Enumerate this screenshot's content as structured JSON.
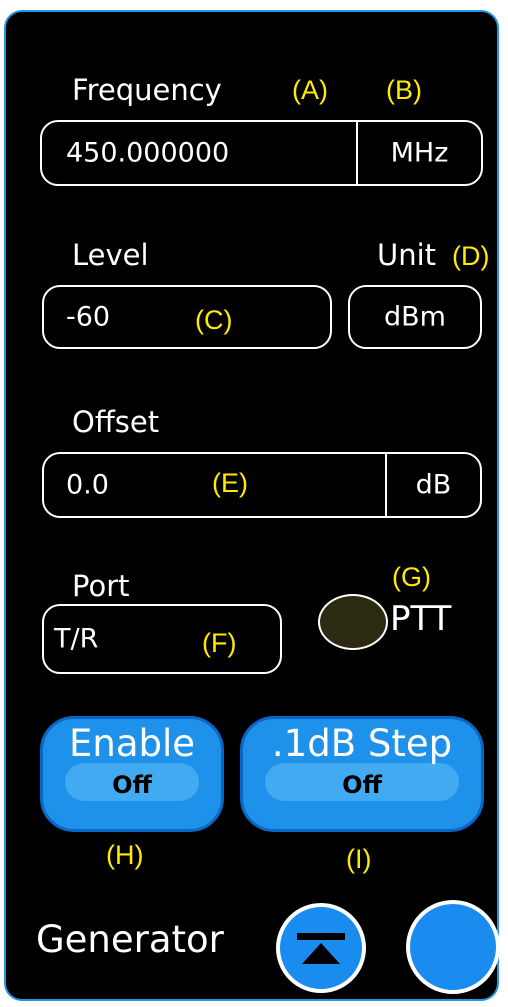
{
  "frequency": {
    "label": "Frequency",
    "value": "450.000000",
    "unit": "MHz"
  },
  "level": {
    "label": "Level",
    "value": "-60"
  },
  "unit": {
    "label": "Unit",
    "value": "dBm"
  },
  "offset": {
    "label": "Offset",
    "value": "0.0",
    "unit": "dB"
  },
  "port": {
    "label": "Port",
    "value": "T/R"
  },
  "ptt": {
    "label": "PTT",
    "indicator_color": "#2c2a10"
  },
  "enable_button": {
    "title": "Enable",
    "state": "Off"
  },
  "step_button": {
    "title": ".1dB Step",
    "state": "Off"
  },
  "footer": {
    "title": "Generator"
  },
  "annotations": {
    "a": "(A)",
    "b": "(B)",
    "c": "(C)",
    "d": "(D)",
    "e": "(E)",
    "f": "(F)",
    "g": "(G)",
    "h": "(H)",
    "i": "(I)"
  },
  "colors": {
    "accent": "#1f97e6",
    "button_fill": "#1e92ea",
    "annotation": "#ffea00"
  },
  "icons": {
    "collapse": "eject-up-icon"
  }
}
